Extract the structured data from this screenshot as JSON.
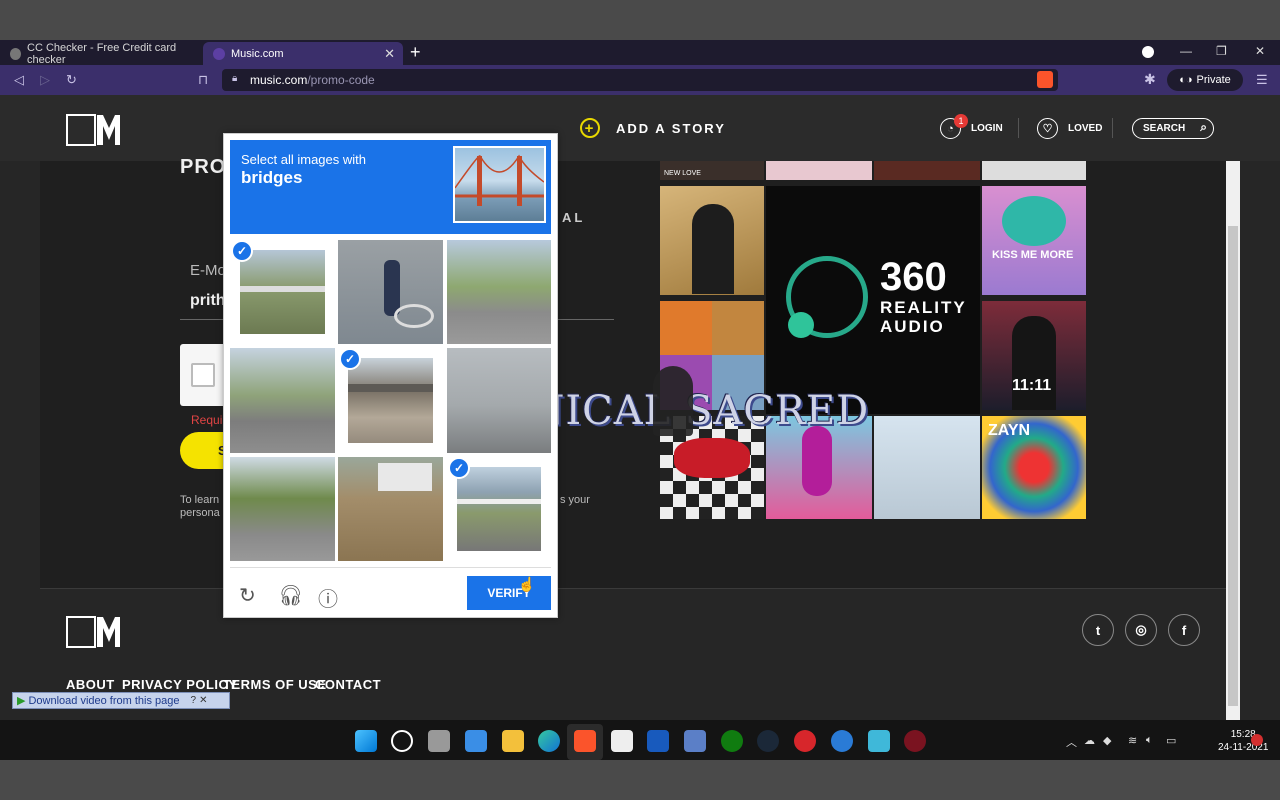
{
  "browser": {
    "tabs": [
      {
        "title": "CC Checker - Free Credit card checker"
      },
      {
        "title": "Music.com"
      }
    ],
    "url_domain": "music.com",
    "url_path": "/promo-code",
    "private_label": "Private"
  },
  "site": {
    "header": {
      "add_story": "ADD A STORY",
      "login": "LOGIN",
      "login_badge": "1",
      "loved": "LOVED",
      "search": "SEARCH"
    },
    "form": {
      "title_partial": "PROM",
      "al_partial": "AL",
      "email_label": "E-Mo",
      "email_value": "prith",
      "required": "Requi",
      "submit_partial": "S",
      "learn_text": "To learn persona",
      "learn_tail": "s your"
    },
    "promo_banner": {
      "number": "360",
      "line1": "REALITY",
      "line2": "AUDIO"
    },
    "album_labels": [
      "NEW LOVE",
      "KISS ME MORE",
      "11:11",
      "ZAYN"
    ],
    "footer": {
      "links": [
        "ABOUT",
        "PRIVACY POLICY",
        "TERMS OF USE",
        "CONTACT"
      ]
    },
    "download_bar": "Download video from this page"
  },
  "captcha": {
    "prompt": "Select all images with",
    "target": "bridges",
    "verify": "VERIFY",
    "tiles": [
      {
        "selected": true
      },
      {
        "selected": false
      },
      {
        "selected": false
      },
      {
        "selected": false
      },
      {
        "selected": true
      },
      {
        "selected": false
      },
      {
        "selected": false
      },
      {
        "selected": false
      },
      {
        "selected": true
      }
    ]
  },
  "watermark": "TECHNICAL SACRED",
  "taskbar": {
    "time": "15:28",
    "date": "24-11-2021"
  },
  "colors": {
    "captcha_blue": "#1a73e8",
    "brand_yellow": "#f5e300",
    "browser_purple": "#3b2f6b"
  }
}
